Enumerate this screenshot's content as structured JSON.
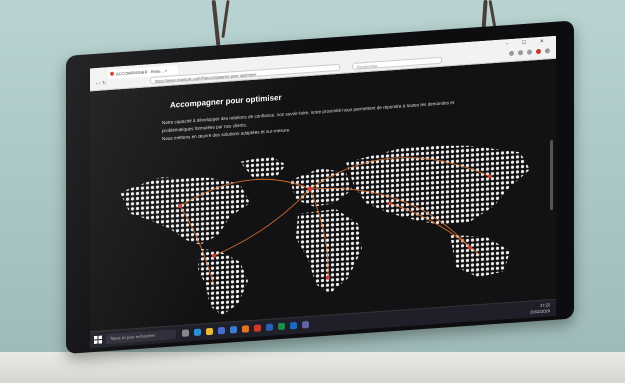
{
  "browser": {
    "tab_title": "ACCOMPAGNER · Beau... ×",
    "url": "https://www.example.com/fr/accompagner-pour-optimiser",
    "search_placeholder": "Rechercher",
    "window_controls": "– ☐ ✕",
    "nav_glyphs": "‹ › ↻"
  },
  "page": {
    "heading": "Accompagner pour optimiser",
    "paragraph_1": "Notre capacité à développer des relations de confiance, nos savoir-faire, notre proximité nous permettent de répondre à toutes les demandes et problématiques formulées par nos clients.",
    "paragraph_2": "Nous mettons en œuvre des solutions adaptées et sur-mesure."
  },
  "map": {
    "dot_color": "#f2f2f2",
    "route_color": "#e0742a",
    "hub_color": "#d0392b"
  },
  "taskbar": {
    "search_placeholder": "Tapez ici pour rechercher",
    "time": "17:22",
    "date": "20/11/2020"
  },
  "colors": {
    "wall": "#a9c6c4",
    "screen_bg": "#121214",
    "accent_orange": "#e0742a"
  }
}
